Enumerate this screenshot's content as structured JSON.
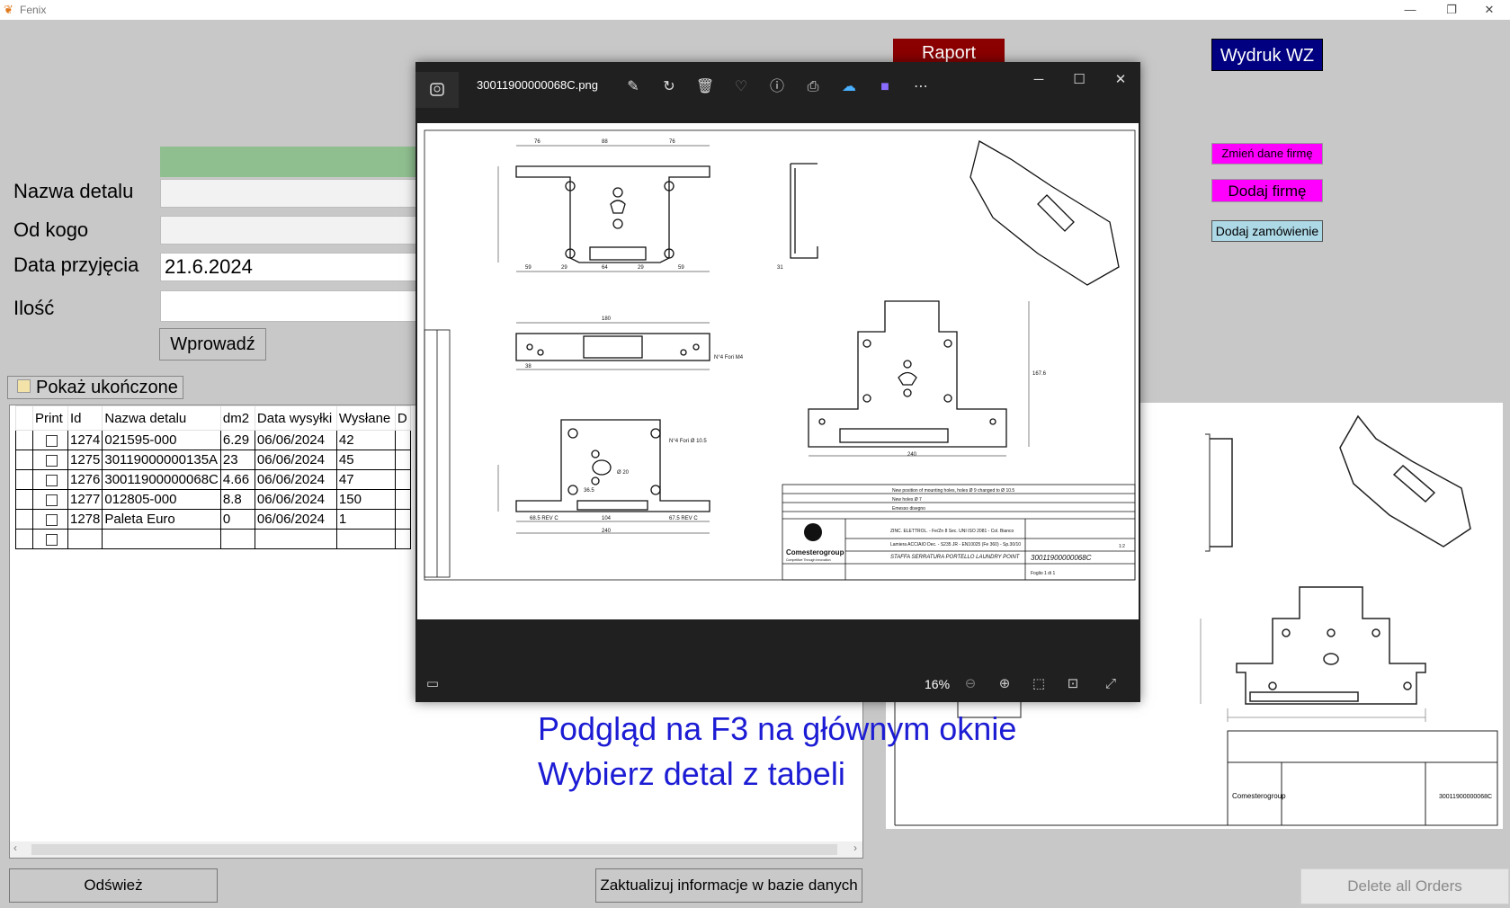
{
  "window": {
    "title": "Fenix",
    "minimize": "—",
    "restore": "❐",
    "close": "✕"
  },
  "form": {
    "labels": {
      "nazwa": "Nazwa detalu",
      "od_kogo": "Od kogo",
      "data": "Data przyjęcia",
      "ilosc": "Ilość"
    },
    "values": {
      "nazwa": "",
      "od_kogo": "",
      "data": "21.6.2024",
      "ilosc": ""
    },
    "submit": "Wprowadź",
    "show_finished": "Pokaż ukończone"
  },
  "buttons": {
    "raport": "Raport",
    "wydruk_wz": "Wydruk WZ",
    "zmien_firme": "Zmień dane firmę",
    "dodaj_firme": "Dodaj firmę",
    "dodaj_zamowienie": "Dodaj zamówienie",
    "odswiez": "Odśwież",
    "zaktualizuj": "Zaktualizuj informacje w bazie danych",
    "delete_all": "Delete all Orders"
  },
  "colors": {
    "raport": "#8b0000",
    "wydruk_wz": "#000080",
    "magenta": "#ff00ff",
    "lightblue": "#add8e6",
    "hint": "#1c1cd4",
    "green_bar": "#8fbf8f"
  },
  "table": {
    "headers": [
      "Print",
      "Id",
      "Nazwa detalu",
      "dm2",
      "Data wysyłki",
      "Wysłane",
      "D"
    ],
    "rows": [
      {
        "id": "1274",
        "nazwa": "021595-000",
        "dm2": "6.29",
        "data": "06/06/2024",
        "wyslane": "42"
      },
      {
        "id": "1275",
        "nazwa": "30119000000135A",
        "dm2": "23",
        "data": "06/06/2024",
        "wyslane": "45"
      },
      {
        "id": "1276",
        "nazwa": "30011900000068C",
        "dm2": "4.66",
        "data": "06/06/2024",
        "wyslane": "47"
      },
      {
        "id": "1277",
        "nazwa": "012805-000",
        "dm2": "8.8",
        "data": "06/06/2024",
        "wyslane": "150"
      },
      {
        "id": "1278",
        "nazwa": "Paleta Euro",
        "dm2": "0",
        "data": "06/06/2024",
        "wyslane": "1"
      }
    ]
  },
  "hints": {
    "line1": "Podgląd na F3 na głównym oknie",
    "line2": "Wybierz detal z tabeli"
  },
  "viewer": {
    "filename": "30011900000068C.png",
    "zoom": "16%",
    "tools": [
      "edit-icon",
      "rotate-icon",
      "delete-icon",
      "favorite-icon",
      "info-icon",
      "print-icon",
      "onedrive-icon",
      "clipchamp-icon",
      "more-icon"
    ],
    "drawing": {
      "company": "Comesterogroup",
      "company_sub": "Competitive Through Innovation",
      "description": "STAFFA SERRATURA PORTELLO LAUNDRY POINT",
      "code": "30011900000068C",
      "material": "Lamiera ACCIAIO Dec. - S235 JR - EN10025 (Fe 360) - Sp.30/10",
      "treatment": "ZINC. ELETTROL. - Fe/Zn 8 Sec. UNI ISO 2081 - Col. Bianco",
      "sheet": "Foglio 1 di 1",
      "scale": "1:2",
      "rev_notes": [
        "New position of mounting holes, holes Ø 9 changed to Ø 10.5",
        "New holes Ø 7",
        "Emesso disegno"
      ],
      "dims": [
        "76",
        "88",
        "76",
        "180",
        "240",
        "59",
        "29",
        "64",
        "29",
        "59",
        "38",
        "31",
        "167.6",
        "104",
        "68.5 REV C",
        "67.5 REV C",
        "36.5",
        "Ø 20",
        "N°4 Fori Ø 10.5",
        "N°4 Fori M4"
      ]
    }
  }
}
